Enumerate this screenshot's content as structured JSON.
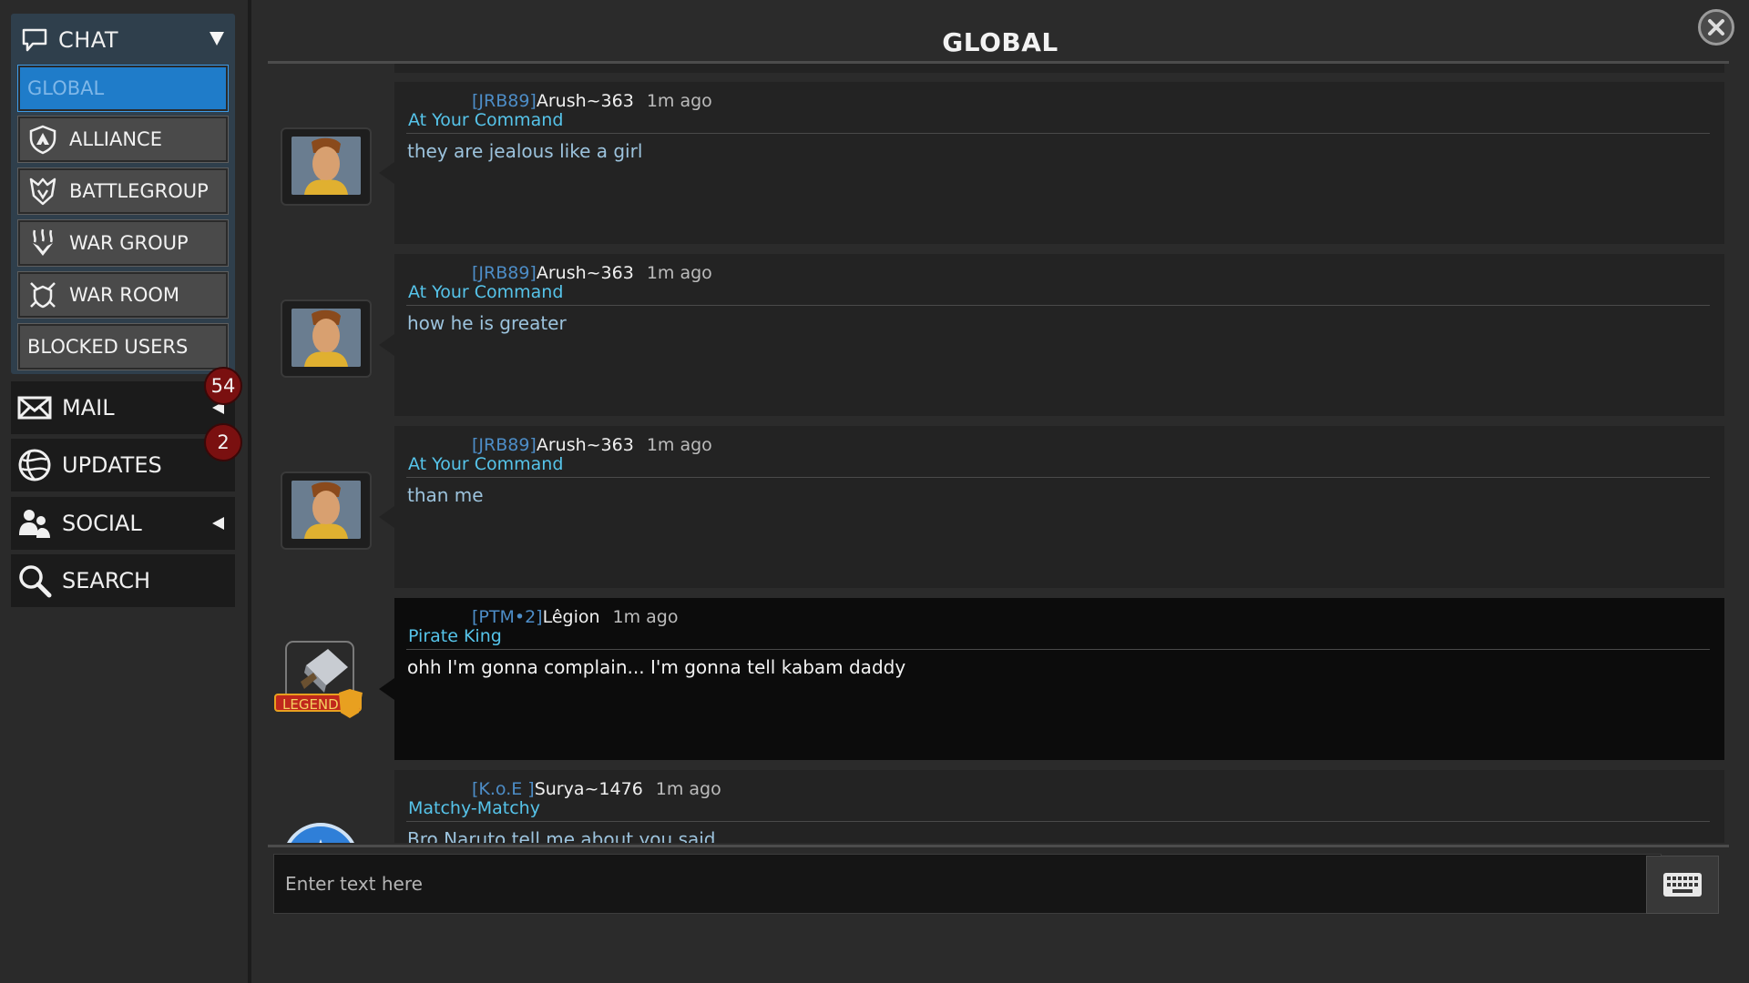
{
  "sidebar": {
    "chat": {
      "label": "CHAT",
      "channels": [
        {
          "label": "GLOBAL",
          "icon": "none",
          "active": true
        },
        {
          "label": "ALLIANCE",
          "icon": "alliance-shield-icon"
        },
        {
          "label": "BATTLEGROUP",
          "icon": "battlegroup-icon"
        },
        {
          "label": "WAR GROUP",
          "icon": "war-group-icon"
        },
        {
          "label": "WAR ROOM",
          "icon": "war-room-icon"
        },
        {
          "label": "BLOCKED USERS",
          "icon": "none"
        }
      ]
    },
    "mail": {
      "label": "MAIL",
      "badge": "54"
    },
    "updates": {
      "label": "UPDATES",
      "badge": "2"
    },
    "social": {
      "label": "SOCIAL"
    },
    "search": {
      "label": "SEARCH"
    }
  },
  "main": {
    "title": "GLOBAL",
    "messages": [
      {
        "tag": "[JRB89]",
        "user": "Arush~363",
        "time": "1m ago",
        "player_title": "At Your Command",
        "text": "they are jealous like a girl",
        "avatar": "hero-portrait"
      },
      {
        "tag": "[JRB89]",
        "user": "Arush~363",
        "time": "1m ago",
        "player_title": "At Your Command",
        "text": "how he is greater",
        "avatar": "hero-portrait"
      },
      {
        "tag": "[JRB89]",
        "user": "Arush~363",
        "time": "1m ago",
        "player_title": "At Your Command",
        "text": "than me",
        "avatar": "hero-portrait"
      },
      {
        "tag": "[PTM•2]",
        "user": "Lêgion",
        "time": "1m ago",
        "player_title": "Pirate King",
        "text": "ohh I'm gonna complain... I'm gonna tell kabam daddy",
        "avatar": "hammer-portrait",
        "avatar_badge": "LEGEND"
      },
      {
        "tag": "[K.o.E ]",
        "user": "Surya~1476",
        "time": "1m ago",
        "player_title": "Matchy-Matchy",
        "text": "Bro Naruto tell me about you said",
        "avatar": "globe-portrait"
      }
    ],
    "input": {
      "placeholder": "Enter text here",
      "value": ""
    }
  },
  "colors": {
    "accent_blue": "#1f7cc9",
    "tag_blue": "#4d8dc7",
    "player_title": "#56c4ea",
    "badge_red": "#7a1010"
  }
}
